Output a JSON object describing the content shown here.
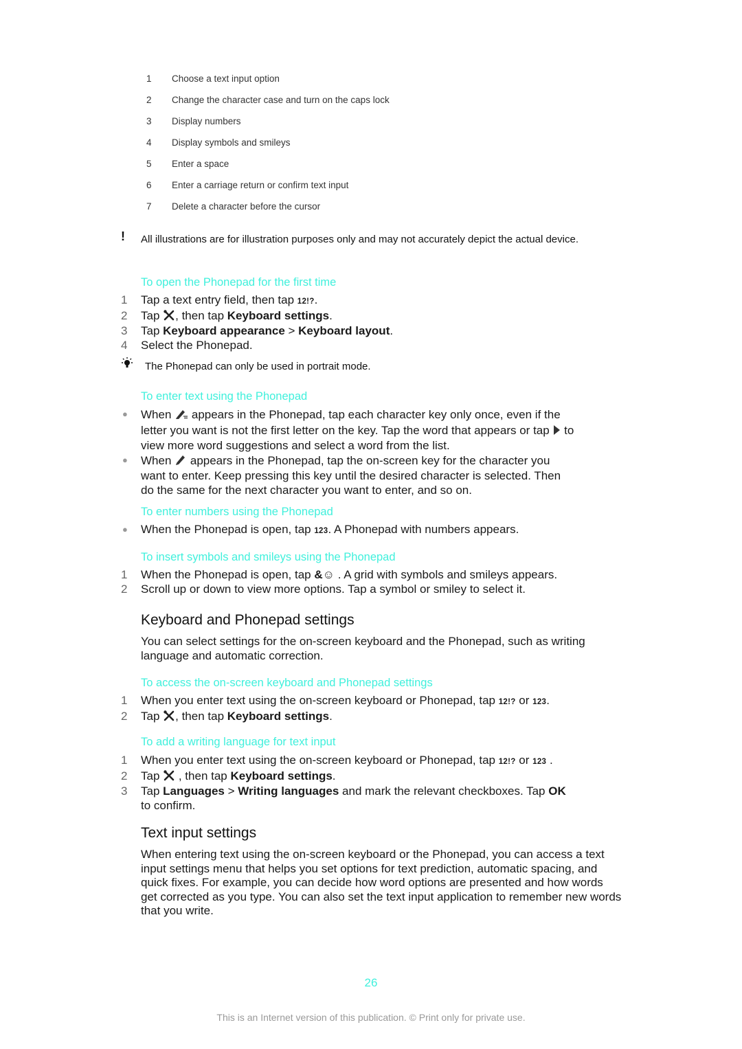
{
  "legend": [
    {
      "num": "1",
      "text": "Choose a text input option"
    },
    {
      "num": "2",
      "text": "Change the character case and turn on the caps lock"
    },
    {
      "num": "3",
      "text": "Display numbers"
    },
    {
      "num": "4",
      "text": "Display symbols and smileys"
    },
    {
      "num": "5",
      "text": "Enter a space"
    },
    {
      "num": "6",
      "text": "Enter a carriage return or confirm text input"
    },
    {
      "num": "7",
      "text": "Delete a character before the cursor"
    }
  ],
  "note_illustrations": {
    "icon": "exclamation-icon",
    "text": "All illustrations are for illustration purposes only and may not accurately depict the actual device."
  },
  "open_phonepad": {
    "title": "To open the Phonepad for the first time",
    "steps": [
      {
        "num": "1",
        "a": "Tap a text entry field, then tap ",
        "key": "12!?",
        "b": "."
      },
      {
        "num": "2",
        "a": "Tap ",
        "b": ", then tap ",
        "bold": "Keyboard settings",
        "c": "."
      },
      {
        "num": "3",
        "a": "Tap ",
        "bold1": "Keyboard appearance",
        "sep": " > ",
        "bold2": "Keyboard layout",
        "c": "."
      },
      {
        "num": "4",
        "a": "Select the Phonepad."
      }
    ]
  },
  "tip_portrait": {
    "icon": "lightbulb-icon",
    "text": "The Phonepad can only be used in portrait mode."
  },
  "enter_text": {
    "title": "To enter text using the Phonepad",
    "bullets": [
      {
        "a": "When ",
        "b": " appears in the Phonepad, tap each character key only once, even if the letter you want is not the first letter on the key. Tap the word that appears or tap ",
        "c": " to view more word suggestions and select a word from the list."
      },
      {
        "a": "When ",
        "b": " appears in the Phonepad, tap the on-screen key for the character you want to enter. Keep pressing this key until the desired character is selected. Then do the same for the next character you want to enter, and so on."
      }
    ]
  },
  "enter_numbers": {
    "title": "To enter numbers using the Phonepad",
    "bullets": [
      {
        "a": "When the Phonepad is open, tap ",
        "key": "123",
        "b": ". A Phonepad with numbers appears."
      }
    ]
  },
  "insert_symbols": {
    "title": "To insert symbols and smileys using the Phonepad",
    "steps": [
      {
        "num": "1",
        "a": "When the Phonepad is open, tap ",
        "key": "&☺",
        "b": " . A grid with symbols and smileys appears."
      },
      {
        "num": "2",
        "a": "Scroll up or down to view more options. Tap a symbol or smiley to select it."
      }
    ]
  },
  "kb_settings": {
    "heading": "Keyboard and Phonepad settings",
    "intro": "You can select settings for the on-screen keyboard and the Phonepad, such as writing language and automatic correction.",
    "access": {
      "title": "To access the on-screen keyboard and Phonepad settings",
      "steps": [
        {
          "num": "1",
          "a": "When you enter text using the on-screen keyboard or Phonepad, tap ",
          "key1": "12!?",
          "or": " or ",
          "key2": "123",
          "b": "."
        },
        {
          "num": "2",
          "a": "Tap ",
          "b": ", then tap ",
          "bold": "Keyboard settings",
          "c": "."
        }
      ]
    },
    "add_language": {
      "title": "To add a writing language for text input",
      "steps": [
        {
          "num": "1",
          "a": "When you enter text using the on-screen keyboard or Phonepad, tap ",
          "key1": "12!?",
          "or": " or ",
          "key2": "123",
          "b": " ."
        },
        {
          "num": "2",
          "a": "Tap ",
          "b": " , then tap ",
          "bold": "Keyboard settings",
          "c": "."
        },
        {
          "num": "3",
          "a": "Tap ",
          "bold1": "Languages",
          "sep": " > ",
          "bold2": "Writing languages",
          "b": " and mark the relevant checkboxes. Tap ",
          "bold3": "OK",
          "c": " to confirm."
        }
      ]
    }
  },
  "text_input_settings": {
    "heading": "Text input settings",
    "body": "When entering text using the on-screen keyboard or the Phonepad, you can access a text input settings menu that helps you set options for text prediction, automatic spacing, and quick fixes. For example, you can decide how word options are presented and how words get corrected as you type. You can also set the text input application to remember new words that you write."
  },
  "page_number": "26",
  "footer": "This is an Internet version of this publication. © Print only for private use.",
  "colors": {
    "accent": "#40f0dc",
    "text": "#1a1a1a",
    "footer": "#999999"
  }
}
